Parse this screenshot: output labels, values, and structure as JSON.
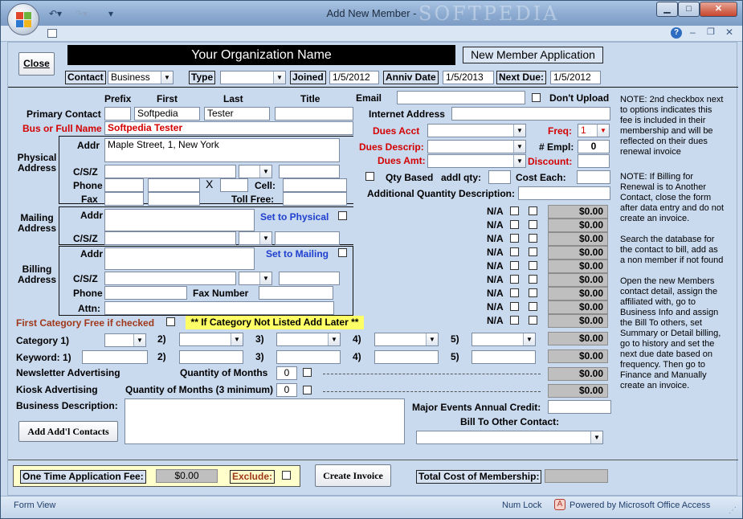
{
  "window": {
    "title": "Add New Member -",
    "watermark": "SOFTPEDIA"
  },
  "colors": {
    "label_red": "#d40000",
    "link_blue": "#1f3fcf",
    "accent_yellow": "#ffff66",
    "header_black": "#000000"
  },
  "header": {
    "close_label": "Close",
    "org_name": "Your Organization Name",
    "app_title": "New Member Application",
    "contact_label": "Contact",
    "contact_value": "Business",
    "type_label": "Type",
    "type_value": "",
    "joined_label": "Joined",
    "joined_value": "1/5/2012",
    "anniv_label": "Anniv Date",
    "anniv_value": "1/5/2013",
    "next_due_label": "Next Due:",
    "next_due_value": "1/5/2012"
  },
  "contact": {
    "prefix_label": "Prefix",
    "first_label": "First",
    "last_label": "Last",
    "title_label": "Title",
    "primary_contact_label": "Primary Contact",
    "prefix": "",
    "first": "Softpedia",
    "last": "Tester",
    "title": "",
    "bus_name_label": "Bus or Full Name",
    "bus_name": "Softpedia Tester"
  },
  "physical": {
    "section_label": "Physical Address",
    "addr_label": "Addr",
    "addr": "Maple Street, 1, New York",
    "csz_label": "C/S/Z",
    "phone_label": "Phone",
    "x_label": "X",
    "cell_label": "Cell:",
    "fax_label": "Fax",
    "tollfree_label": "Toll Free:"
  },
  "mailing": {
    "section_label": "Mailing Address",
    "addr_label": "Addr",
    "csz_label": "C/S/Z",
    "set_link": "Set to Physical"
  },
  "billing": {
    "section_label": "Billing Address",
    "addr_label": "Addr",
    "csz_label": "C/S/Z",
    "set_link": "Set to Mailing",
    "phone_label": "Phone",
    "fax_label": "Fax Number",
    "attn_label": "Attn:"
  },
  "email": {
    "label": "Email",
    "dont_upload": "Don't Upload",
    "internet_label": "Internet Address"
  },
  "dues": {
    "acct_label": "Dues Acct",
    "freq_label": "Freq:",
    "freq_value": "1",
    "descrip_label": "Dues Descrip:",
    "empl_label": "# Empl:",
    "empl_value": "0",
    "amt_label": "Dues Amt:",
    "discount_label": "Discount:",
    "qty_based": "Qty Based",
    "addl_qty": "addl qty:",
    "cost_each": "Cost Each:",
    "addl_desc_label": "Additional Quantity Description:"
  },
  "options": {
    "na_label": "N/A",
    "amounts": [
      "$0.00",
      "$0.00",
      "$0.00",
      "$0.00",
      "$0.00",
      "$0.00",
      "$0.00",
      "$0.00",
      "$0.00"
    ]
  },
  "notes": [
    "NOTE: 2nd checkbox next to options indicates this fee is included in their membership and will be reflected on their dues renewal invoice",
    "NOTE: If Billing for Renewal is to Another Contact, close the form after data entry and do not create an invoice.",
    "Search the database for the contact to bill, add as a non member if not found",
    "Open the new Members contact detail, assign the affiliated with, go to Business Info and assign the Bill To others, set Summary or Detail billing, go to history and set the next due date based on frequency. Then go to Finance and Manually create an invoice."
  ],
  "category": {
    "free_label": "First Category Free if checked",
    "not_listed": "** If Category Not Listed Add Later **",
    "category_label": "Category 1)",
    "keyword_label": "Keyword: 1)",
    "n2": "2)",
    "n3": "3)",
    "n4": "4)",
    "n5": "5)",
    "cat_amount": "$0.00",
    "kw_amount": "$0.00"
  },
  "advertising": {
    "newsletter_label": "Newsletter Advertising",
    "newsletter_qty_label": "Quantity of Months",
    "newsletter_qty": "0",
    "newsletter_amount": "$0.00",
    "kiosk_label": "Kiosk Advertising",
    "kiosk_qty_label": "Quantity of Months (3 minimum)",
    "kiosk_qty": "0",
    "kiosk_amount": "$0.00"
  },
  "business": {
    "desc_label": "Business Description:",
    "add_contacts": "Add Add'l Contacts",
    "major_events": "Major Events Annual Credit:",
    "bill_to_other": "Bill To Other Contact:"
  },
  "footer": {
    "onetime_label": "One Time Application Fee:",
    "onetime_value": "$0.00",
    "exclude_label": "Exclude:",
    "create_invoice": "Create Invoice",
    "total_label": "Total Cost of Membership:"
  },
  "status": {
    "left": "Form View",
    "numlock": "Num Lock",
    "powered": "Powered by Microsoft Office Access"
  }
}
